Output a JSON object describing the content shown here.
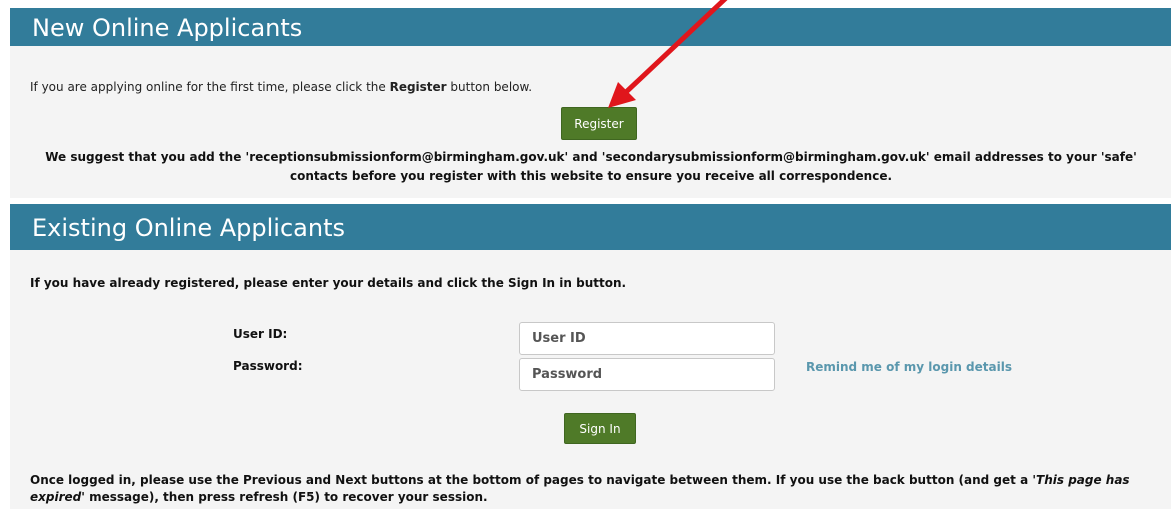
{
  "new_section": {
    "title": "New Online Applicants",
    "intro_before": "If you are applying online for the first time, please click the ",
    "intro_bold": "Register",
    "intro_after": " button below.",
    "register_label": "Register",
    "suggestion": "We suggest that you add the 'receptionsubmissionform@birmingham.gov.uk' and 'secondarysubmissionform@birmingham.gov.uk' email addresses to your 'safe' contacts before you register with this website to ensure you receive all correspondence."
  },
  "existing_section": {
    "title": "Existing Online Applicants",
    "intro": "If you have already registered, please enter your details and click the Sign In in button.",
    "user_label": "User ID:",
    "user_placeholder": "User ID",
    "password_label": "Password:",
    "password_placeholder": "Password",
    "remind_link": "Remind me of my login details",
    "signin_label": "Sign In",
    "footer_part1": "Once logged in, please use the Previous and Next buttons at the bottom of pages to navigate between them. If you use the back button (and get a ",
    "footer_italic": "'This page has expired'",
    "footer_part2": " message), then press refresh (F5) to recover your session."
  },
  "colors": {
    "banner": "#327c9a",
    "button": "#4f7a28",
    "link": "#5a97ad",
    "arrow": "#e0161c"
  }
}
